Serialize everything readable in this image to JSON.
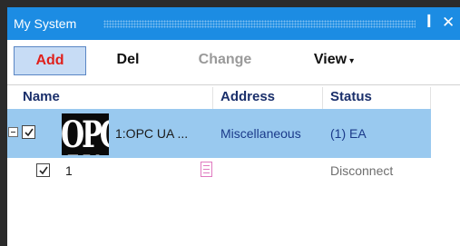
{
  "panel": {
    "title": "My System",
    "pin_glyph": "ꟾ",
    "close_glyph": "✕"
  },
  "toolbar": {
    "add_label": "Add",
    "del_label": "Del",
    "change_label": "Change",
    "view_label": "View",
    "view_caret": "▾"
  },
  "columns": {
    "name": "Name",
    "address": "Address",
    "status": "Status"
  },
  "rows": [
    {
      "logo_text": "OPC UA",
      "name": "1:OPC UA ...",
      "address": "Miscellaneous",
      "status": "(1) EA",
      "checked": true,
      "expanded": true,
      "selected": true
    },
    {
      "name": "1",
      "address": "",
      "status": "Disconnect",
      "checked": true,
      "selected": false
    }
  ],
  "colors": {
    "title_bar": "#1c8ce3",
    "selection": "#99c9ef",
    "add_text": "#e0201b",
    "header_text": "#1a2f6b"
  },
  "icons": [
    "pin-icon",
    "close-icon",
    "expander-minus-icon",
    "checkbox-icon",
    "opc-ua-logo",
    "document-icon",
    "chevron-down-icon"
  ]
}
